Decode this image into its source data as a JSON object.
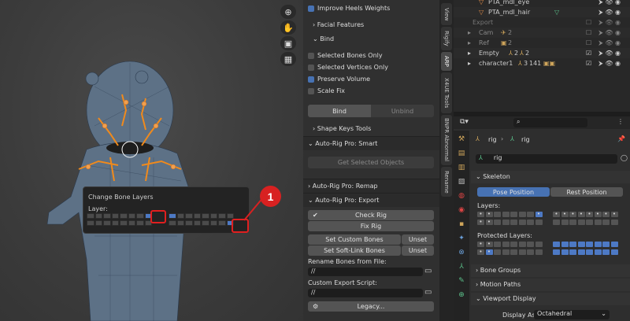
{
  "viewport": {
    "popup_title": "Change Bone Layers",
    "popup_layer_label": "Layer:",
    "badge": "1"
  },
  "npanel": {
    "top_item": "Improve Heels Weights",
    "facial": "Facial Features",
    "bind_header": "Bind",
    "checks": [
      {
        "label": "Selected Bones Only",
        "on": false
      },
      {
        "label": "Selected Vertices Only",
        "on": false
      },
      {
        "label": "Preserve Volume",
        "on": true
      },
      {
        "label": "Scale Fix",
        "on": false
      }
    ],
    "bind_btn": "Bind",
    "unbind_btn": "Unbind",
    "shape_keys": "Shape Keys Tools",
    "smart": "Auto-Rig Pro: Smart",
    "get_selected": "Get Selected Objects",
    "remap": "Auto-Rig Pro: Remap",
    "export": "Auto-Rig Pro: Export",
    "check_rig": "Check Rig",
    "fix_rig": "Fix Rig",
    "set_custom": "Set Custom Bones",
    "unset": "Unset",
    "set_softlink": "Set Soft-Link Bones",
    "rename_label": "Rename Bones from File:",
    "rename_val": "//",
    "custom_script_label": "Custom Export Script:",
    "custom_script_val": "//",
    "legacy": "Legacy..."
  },
  "vtabs": [
    "View",
    "Rigify",
    "ARP",
    "X4UE Tools",
    "BNPR Abnormal",
    "Rename"
  ],
  "outliner": {
    "rows": [
      {
        "name": "PTA_mdl_eye",
        "indent": 3
      },
      {
        "name": "PTA_mdl_hair",
        "indent": 3
      },
      {
        "name": "Export",
        "indent": 1
      },
      {
        "name": "Cam",
        "indent": 1
      },
      {
        "name": "Ref",
        "indent": 1
      },
      {
        "name": "Empty",
        "indent": 1
      },
      {
        "name": "character1",
        "indent": 1
      }
    ],
    "counts": [
      "2",
      "2",
      "2",
      "2",
      "3",
      "141"
    ]
  },
  "props": {
    "search_placeholder": "",
    "breadcrumb_obj": "rig",
    "breadcrumb_data": "rig",
    "name_field": "rig",
    "skeleton": "Skeleton",
    "pose_position": "Pose Position",
    "rest_position": "Rest Position",
    "layers_label": "Layers:",
    "protected_label": "Protected Layers:",
    "bone_groups": "Bone Groups",
    "motion_paths": "Motion Paths",
    "viewport_display": "Viewport Display",
    "display_as_label": "Display As",
    "display_as_value": "Octahedral"
  },
  "colors": {
    "accent": "#4772b3",
    "badge": "#d82121",
    "highlight_box": "#e01f1f"
  }
}
